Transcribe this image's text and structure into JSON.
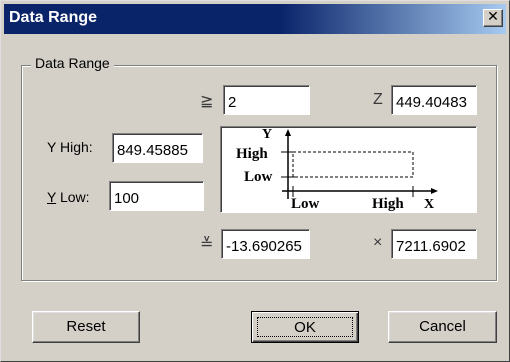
{
  "window": {
    "title": "Data Range",
    "close_glyph": "✕"
  },
  "group": {
    "label": "Data Range"
  },
  "z_low": {
    "symbol": "≧",
    "value": "2"
  },
  "z_high": {
    "symbol": "Z",
    "value": "449.40483"
  },
  "y_high": {
    "label": "Y High:",
    "value": "849.45885"
  },
  "y_low": {
    "label_mnemonic": "Y",
    "label_rest": " Low:",
    "value": "100"
  },
  "x_low": {
    "symbol": "≚",
    "value": "-13.690265"
  },
  "x_high": {
    "symbol": "×",
    "value": "7211.6902"
  },
  "diagram": {
    "y_axis": "Y",
    "x_axis": "X",
    "high_y": "High",
    "low_y": "Low",
    "low_x": "Low",
    "high_x": "High"
  },
  "buttons": {
    "reset": "Reset",
    "ok": "OK",
    "cancel": "Cancel"
  }
}
